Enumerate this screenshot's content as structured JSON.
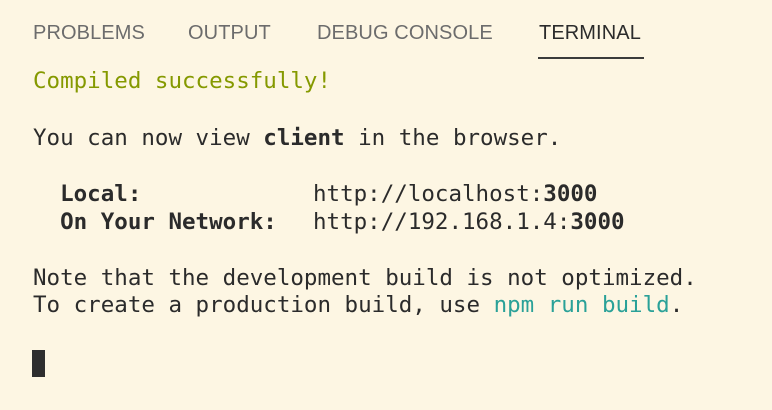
{
  "tabs": [
    {
      "label": "PROBLEMS",
      "active": false
    },
    {
      "label": "OUTPUT",
      "active": false
    },
    {
      "label": "DEBUG CONSOLE",
      "active": false
    },
    {
      "label": "TERMINAL",
      "active": true
    }
  ],
  "terminal": {
    "compiled": "Compiled successfully!",
    "view_prefix": "You can now view ",
    "app_name": "client",
    "view_suffix": " in the browser.",
    "local_label": "  Local:",
    "local_url_prefix": "http://localhost:",
    "local_port": "3000",
    "network_label": "  On Your Network:",
    "network_url_prefix": "http://192.168.1.4:",
    "network_port": "3000",
    "note_line": "Note that the development build is not optimized.",
    "build_prefix": "To create a production build, use ",
    "build_cmd": "npm run build",
    "build_suffix": "."
  },
  "colors": {
    "background": "#fdf6e3",
    "success_green": "#859900",
    "command_cyan": "#2aa198",
    "text": "#2b2b2b",
    "inactive_tab": "#6c6c6c"
  }
}
